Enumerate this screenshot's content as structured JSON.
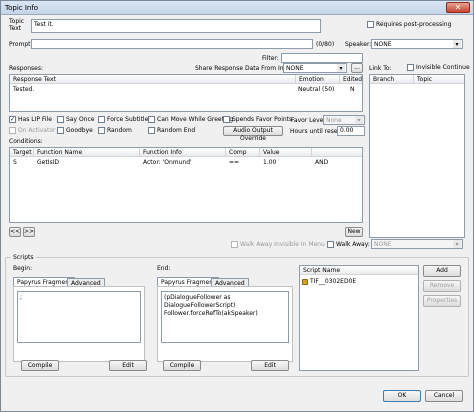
{
  "window": {
    "title": "Topic Info"
  },
  "topic": {
    "label_line1": "Topic",
    "label_line2": "Text",
    "value": "Test it.",
    "requires_postprocessing": "Requires post-processing"
  },
  "prompt": {
    "label": "Prompt:",
    "value": "",
    "counter": "(0/80)"
  },
  "speaker": {
    "label": "Speaker:",
    "value": "NONE"
  },
  "filter": {
    "label": "Filter:"
  },
  "responses": {
    "label": "Responses:",
    "share_label": "Share Response Data From Info:",
    "share_value": "NONE",
    "share_btn": "...",
    "columns": [
      "Response Text",
      "Emotion",
      "Edited"
    ],
    "rows": [
      {
        "text": "Tested.",
        "emotion": "Neutral (50)",
        "edited": "N"
      }
    ]
  },
  "link_to": {
    "label": "Link To:",
    "invisible_continue": "Invisible Continue",
    "columns": [
      "Branch",
      "Topic"
    ]
  },
  "flags": {
    "has_lip": "Has LIP File",
    "on_activator": "On Activator",
    "say_once": "Say Once",
    "goodbye": "Goodbye",
    "force_subtitle": "Force Subtitle",
    "random": "Random",
    "can_move": "Can Move While Greeting",
    "random_end": "Random End",
    "spends_favor": "Spends Favor Points",
    "audio_override": "Audio Output Override",
    "favor_level_label": "Favor Level:",
    "favor_level_value": "None",
    "hours_label": "Hours until reset:",
    "hours_value": "0.00"
  },
  "conditions": {
    "label": "Conditions:",
    "columns": [
      "Target",
      "Function Name",
      "Function Info",
      "Comp",
      "Value",
      ""
    ],
    "rows": [
      {
        "target": "S",
        "function": "GetIsID",
        "info": "Actor: 'Onmund'",
        "comp": "==",
        "value": "1.00",
        "andor": "AND"
      }
    ],
    "prev": "<<",
    "next": ">>",
    "new_btn": "New"
  },
  "walk": {
    "invisible_menu": "Walk Away Invisible In Menu",
    "walk_away": "Walk Away:",
    "walk_value": "NONE"
  },
  "scripts": {
    "label": "Scripts",
    "begin": {
      "label": "Begin:",
      "tab1": "Papyrus Fragment",
      "tab2": "Advanced",
      "code": ";",
      "compile": "Compile",
      "edit": "Edit"
    },
    "end": {
      "label": "End:",
      "tab1": "Papyrus Fragment",
      "tab2": "Advanced",
      "code_line1": "(pDialogueFollower as DialogueFollowerScript)",
      "code_line2": "Follower.forceRefTo(akSpeaker)",
      "compile": "Compile",
      "edit": "Edit"
    },
    "list": {
      "column": "Script Name",
      "item": "TIF__0302ED0E"
    },
    "add": "Add",
    "remove": "Remove",
    "properties": "Properties"
  },
  "footer": {
    "ok": "OK",
    "cancel": "Cancel"
  }
}
